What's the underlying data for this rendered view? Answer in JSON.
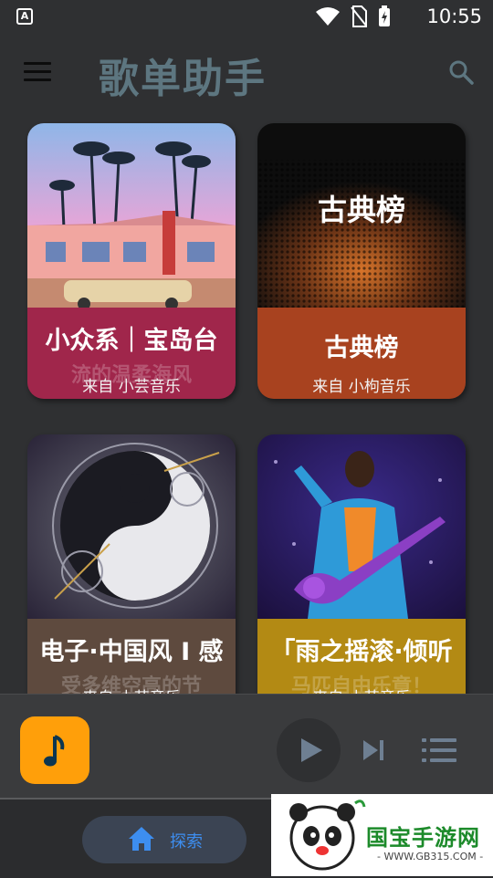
{
  "status_bar": {
    "time": "10:55",
    "app_badge": "A"
  },
  "app_bar": {
    "title": "歌单助手"
  },
  "cards": [
    {
      "title": "小众系｜宝岛台",
      "subtitle_ghost": "流的温柔海风",
      "source": "来自 小芸音乐",
      "color": "#a0264b",
      "image": "palm-trees-house-sunset"
    },
    {
      "title": "古典榜",
      "image_label": "古典榜",
      "source": "来自 小枸音乐",
      "color": "#a8421f",
      "image": "dark-speaker-texture"
    },
    {
      "title": "电子·中国风 I 感",
      "subtitle_ghost": "受多维空高的节",
      "source": "来自 小芸音乐",
      "color": "#5e4a3e",
      "image": "mechanical-yin-yang"
    },
    {
      "title": "「雨之摇滚·倾听",
      "subtitle_ghost": "马匹自由乐章！",
      "source": "来自 小芸音乐",
      "color": "#b38a14",
      "image": "performer-purple-guitar"
    }
  ],
  "player": {
    "art_color": "#ff9f0a",
    "art_icon": "music-note-icon"
  },
  "bottom_nav": {
    "explore_label": "探索"
  },
  "watermark": {
    "brand": "国宝手游网",
    "url": "- WWW.GB315.COM -"
  }
}
